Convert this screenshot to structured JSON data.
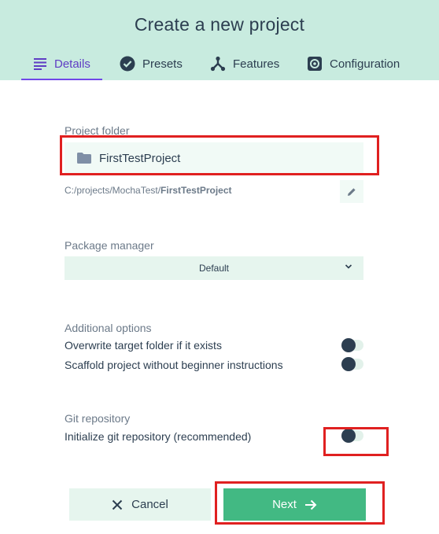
{
  "header": {
    "title": "Create a new project",
    "tabs": [
      {
        "label": "Details",
        "icon": "details-list-icon",
        "active": true
      },
      {
        "label": "Presets",
        "icon": "check-circle-icon",
        "active": false
      },
      {
        "label": "Features",
        "icon": "fork-icon",
        "active": false
      },
      {
        "label": "Configuration",
        "icon": "gear-icon",
        "active": false
      }
    ]
  },
  "project_folder": {
    "label": "Project folder",
    "value": "FirstTestProject",
    "path_prefix": "C:/projects/MochaTest/",
    "path_name": "FirstTestProject"
  },
  "package_manager": {
    "label": "Package manager",
    "selected": "Default"
  },
  "additional_options": {
    "label": "Additional options",
    "options": [
      {
        "label": "Overwrite target folder if it exists",
        "enabled": false
      },
      {
        "label": "Scaffold project without beginner instructions",
        "enabled": false
      }
    ]
  },
  "git": {
    "label": "Git repository",
    "option": {
      "label": "Initialize git repository (recommended)",
      "enabled": false
    }
  },
  "footer": {
    "cancel_label": "Cancel",
    "next_label": "Next"
  },
  "colors": {
    "header_bg": "#c8ebdf",
    "accent": "#42b983",
    "active_tab": "#5f3dc4",
    "highlight": "#e02020"
  }
}
